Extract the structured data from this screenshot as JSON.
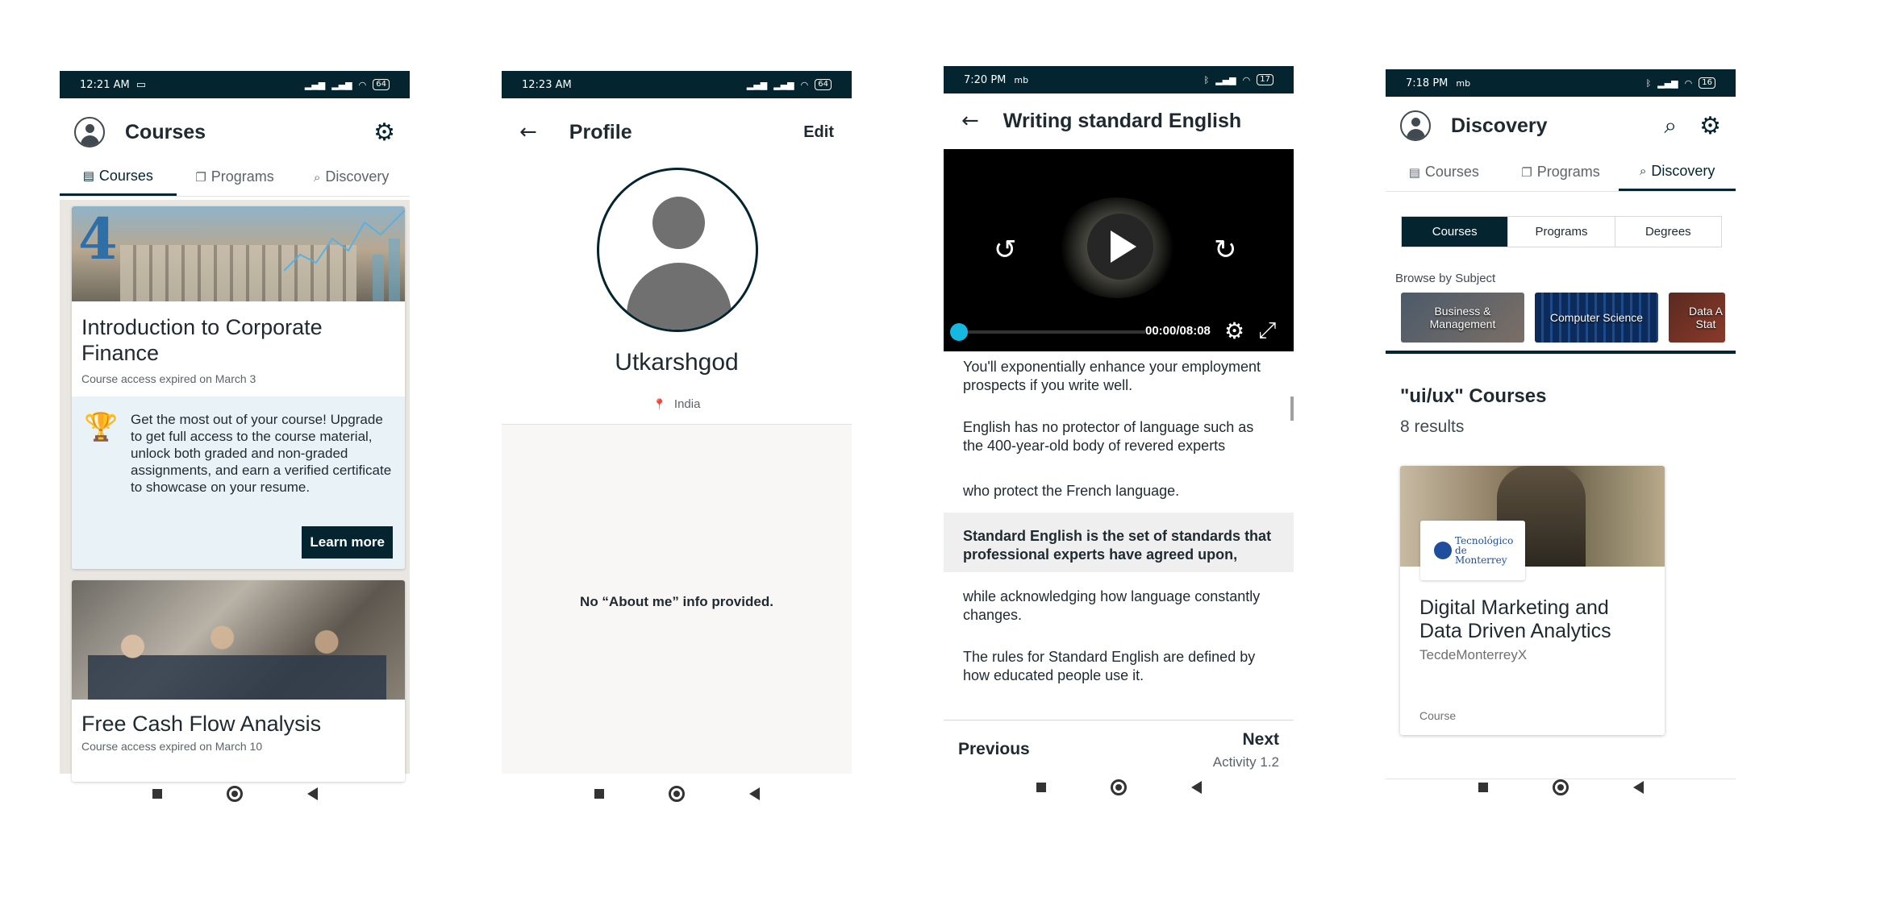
{
  "screen1": {
    "status_time": "12:21 AM",
    "battery": "64",
    "title": "Courses",
    "tabs": [
      {
        "label": "Courses",
        "icon": "book-icon"
      },
      {
        "label": "Programs",
        "icon": "copy-icon"
      },
      {
        "label": "Discovery",
        "icon": "search-icon"
      }
    ],
    "card1": {
      "title": "Introduction to Corporate Finance",
      "subtitle": "Course access expired on March 3",
      "upsell_text": "Get the most out of your course! Upgrade to get full access to the course material, unlock both graded and non-graded assignments, and earn a verified certificate to showcase on your resume.",
      "button": "Learn more"
    },
    "card2": {
      "title": "Free Cash Flow Analysis",
      "subtitle": "Course access expired on March 10"
    }
  },
  "screen2": {
    "status_time": "12:23 AM",
    "battery": "64",
    "title": "Profile",
    "edit": "Edit",
    "username": "Utkarshgod",
    "location": "India",
    "about": "No “About me” info provided."
  },
  "screen3": {
    "status_time": "7:20 PM",
    "status_extra": "mb",
    "battery": "17",
    "title": "Writing standard English",
    "video_time": "00:00/08:08",
    "transcript": [
      "You'll exponentially enhance your employment prospects if you write well.",
      "English has no protector of language such as the 400-year-old body of revered experts",
      "who protect the French language.",
      "Standard English is the set of standards that professional experts have agreed upon,",
      "while acknowledging how language constantly changes.",
      "The rules for Standard English are defined by how educated people use it."
    ],
    "previous": "Previous",
    "next": "Next",
    "next_sub": "Activity 1.2"
  },
  "screen4": {
    "status_time": "7:18 PM",
    "status_extra": "mb",
    "battery": "16",
    "title": "Discovery",
    "tabs": [
      {
        "label": "Courses",
        "icon": "book-icon"
      },
      {
        "label": "Programs",
        "icon": "copy-icon"
      },
      {
        "label": "Discovery",
        "icon": "search-icon"
      }
    ],
    "segments": [
      "Courses",
      "Programs",
      "Degrees"
    ],
    "browse_label": "Browse by Subject",
    "subjects": [
      "Business & Management",
      "Computer Science",
      "Data A Stat"
    ],
    "results_title": "\"ui/ux\" Courses",
    "results_count": "8 results",
    "course": {
      "logo_text": "Tecnológico de Monterrey",
      "title": "Digital Marketing and Data Driven Analytics",
      "org": "TecdeMonterreyX",
      "type": "Course"
    }
  },
  "colors": {
    "primary": "#04252f",
    "accent": "#15b8e0",
    "upsell_bg": "#e9f3f7"
  }
}
